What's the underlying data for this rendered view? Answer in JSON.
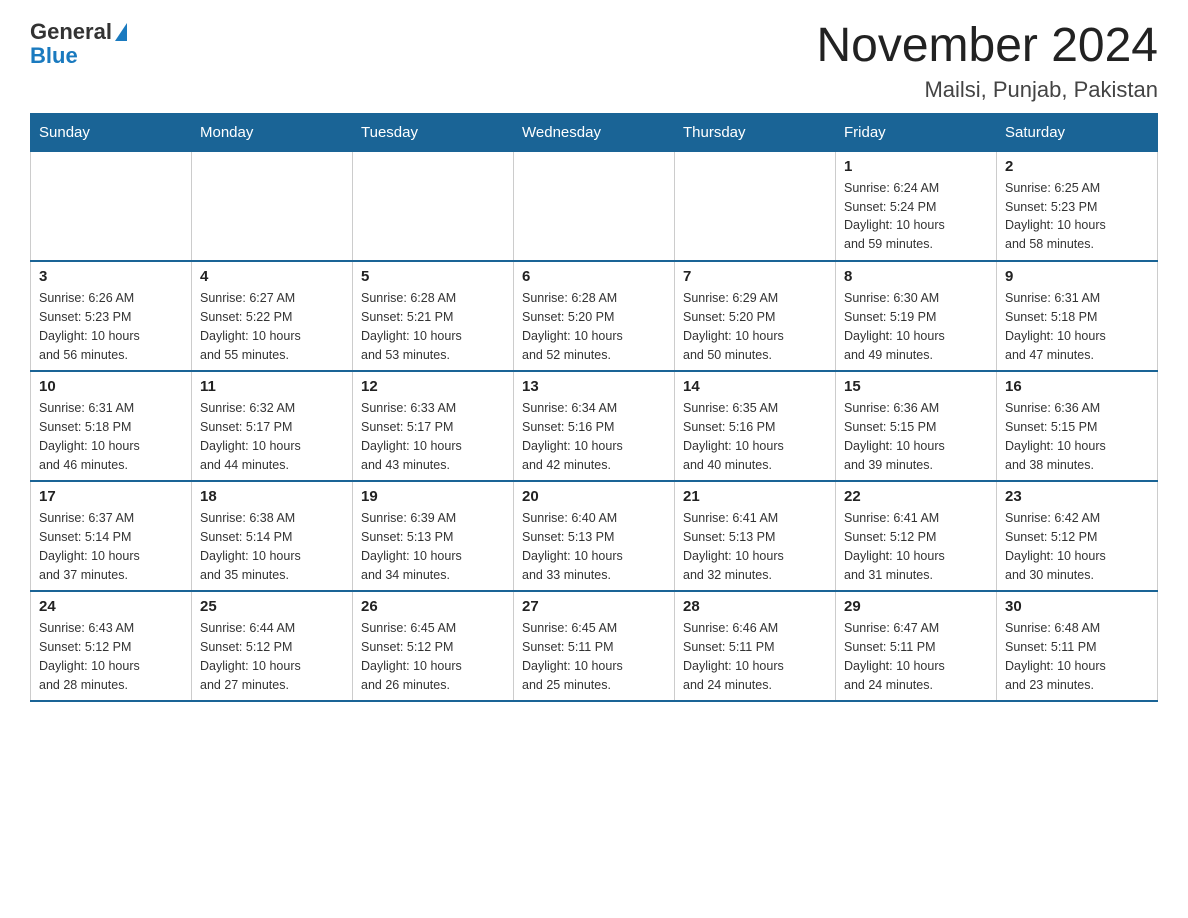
{
  "header": {
    "logo_general": "General",
    "logo_blue": "Blue",
    "title": "November 2024",
    "subtitle": "Mailsi, Punjab, Pakistan"
  },
  "weekdays": [
    "Sunday",
    "Monday",
    "Tuesday",
    "Wednesday",
    "Thursday",
    "Friday",
    "Saturday"
  ],
  "weeks": [
    [
      {
        "day": "",
        "info": ""
      },
      {
        "day": "",
        "info": ""
      },
      {
        "day": "",
        "info": ""
      },
      {
        "day": "",
        "info": ""
      },
      {
        "day": "",
        "info": ""
      },
      {
        "day": "1",
        "info": "Sunrise: 6:24 AM\nSunset: 5:24 PM\nDaylight: 10 hours\nand 59 minutes."
      },
      {
        "day": "2",
        "info": "Sunrise: 6:25 AM\nSunset: 5:23 PM\nDaylight: 10 hours\nand 58 minutes."
      }
    ],
    [
      {
        "day": "3",
        "info": "Sunrise: 6:26 AM\nSunset: 5:23 PM\nDaylight: 10 hours\nand 56 minutes."
      },
      {
        "day": "4",
        "info": "Sunrise: 6:27 AM\nSunset: 5:22 PM\nDaylight: 10 hours\nand 55 minutes."
      },
      {
        "day": "5",
        "info": "Sunrise: 6:28 AM\nSunset: 5:21 PM\nDaylight: 10 hours\nand 53 minutes."
      },
      {
        "day": "6",
        "info": "Sunrise: 6:28 AM\nSunset: 5:20 PM\nDaylight: 10 hours\nand 52 minutes."
      },
      {
        "day": "7",
        "info": "Sunrise: 6:29 AM\nSunset: 5:20 PM\nDaylight: 10 hours\nand 50 minutes."
      },
      {
        "day": "8",
        "info": "Sunrise: 6:30 AM\nSunset: 5:19 PM\nDaylight: 10 hours\nand 49 minutes."
      },
      {
        "day": "9",
        "info": "Sunrise: 6:31 AM\nSunset: 5:18 PM\nDaylight: 10 hours\nand 47 minutes."
      }
    ],
    [
      {
        "day": "10",
        "info": "Sunrise: 6:31 AM\nSunset: 5:18 PM\nDaylight: 10 hours\nand 46 minutes."
      },
      {
        "day": "11",
        "info": "Sunrise: 6:32 AM\nSunset: 5:17 PM\nDaylight: 10 hours\nand 44 minutes."
      },
      {
        "day": "12",
        "info": "Sunrise: 6:33 AM\nSunset: 5:17 PM\nDaylight: 10 hours\nand 43 minutes."
      },
      {
        "day": "13",
        "info": "Sunrise: 6:34 AM\nSunset: 5:16 PM\nDaylight: 10 hours\nand 42 minutes."
      },
      {
        "day": "14",
        "info": "Sunrise: 6:35 AM\nSunset: 5:16 PM\nDaylight: 10 hours\nand 40 minutes."
      },
      {
        "day": "15",
        "info": "Sunrise: 6:36 AM\nSunset: 5:15 PM\nDaylight: 10 hours\nand 39 minutes."
      },
      {
        "day": "16",
        "info": "Sunrise: 6:36 AM\nSunset: 5:15 PM\nDaylight: 10 hours\nand 38 minutes."
      }
    ],
    [
      {
        "day": "17",
        "info": "Sunrise: 6:37 AM\nSunset: 5:14 PM\nDaylight: 10 hours\nand 37 minutes."
      },
      {
        "day": "18",
        "info": "Sunrise: 6:38 AM\nSunset: 5:14 PM\nDaylight: 10 hours\nand 35 minutes."
      },
      {
        "day": "19",
        "info": "Sunrise: 6:39 AM\nSunset: 5:13 PM\nDaylight: 10 hours\nand 34 minutes."
      },
      {
        "day": "20",
        "info": "Sunrise: 6:40 AM\nSunset: 5:13 PM\nDaylight: 10 hours\nand 33 minutes."
      },
      {
        "day": "21",
        "info": "Sunrise: 6:41 AM\nSunset: 5:13 PM\nDaylight: 10 hours\nand 32 minutes."
      },
      {
        "day": "22",
        "info": "Sunrise: 6:41 AM\nSunset: 5:12 PM\nDaylight: 10 hours\nand 31 minutes."
      },
      {
        "day": "23",
        "info": "Sunrise: 6:42 AM\nSunset: 5:12 PM\nDaylight: 10 hours\nand 30 minutes."
      }
    ],
    [
      {
        "day": "24",
        "info": "Sunrise: 6:43 AM\nSunset: 5:12 PM\nDaylight: 10 hours\nand 28 minutes."
      },
      {
        "day": "25",
        "info": "Sunrise: 6:44 AM\nSunset: 5:12 PM\nDaylight: 10 hours\nand 27 minutes."
      },
      {
        "day": "26",
        "info": "Sunrise: 6:45 AM\nSunset: 5:12 PM\nDaylight: 10 hours\nand 26 minutes."
      },
      {
        "day": "27",
        "info": "Sunrise: 6:45 AM\nSunset: 5:11 PM\nDaylight: 10 hours\nand 25 minutes."
      },
      {
        "day": "28",
        "info": "Sunrise: 6:46 AM\nSunset: 5:11 PM\nDaylight: 10 hours\nand 24 minutes."
      },
      {
        "day": "29",
        "info": "Sunrise: 6:47 AM\nSunset: 5:11 PM\nDaylight: 10 hours\nand 24 minutes."
      },
      {
        "day": "30",
        "info": "Sunrise: 6:48 AM\nSunset: 5:11 PM\nDaylight: 10 hours\nand 23 minutes."
      }
    ]
  ]
}
